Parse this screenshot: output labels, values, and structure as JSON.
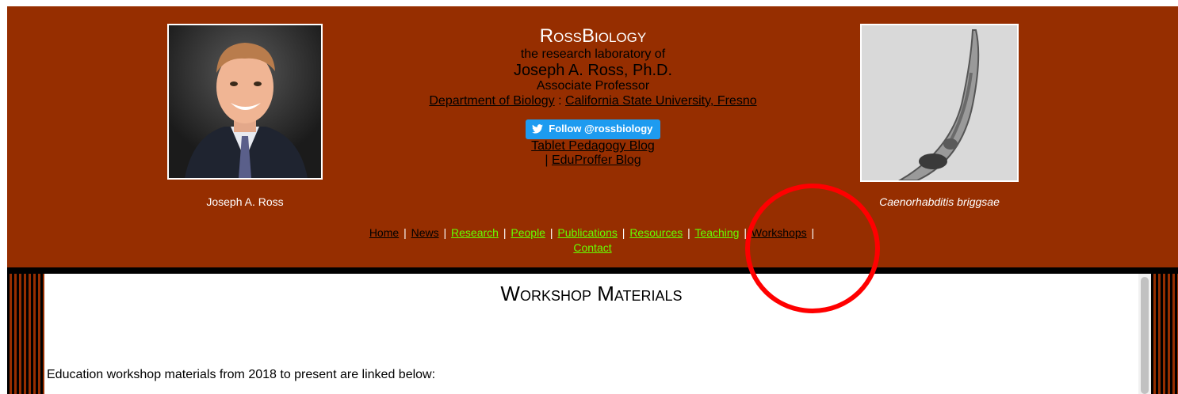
{
  "header": {
    "portrait_caption": "Joseph A. Ross",
    "worm_caption": "Caenorhabditis briggsae",
    "site_title": "RossBiology",
    "subtitle": "the research laboratory of",
    "pi_name": "Joseph A. Ross, Ph.D.",
    "pi_title": "Associate Professor",
    "department_link": "Department of Biology",
    "dept_separator": ":",
    "university_link": "California State University, Fresno",
    "follow_button": "Follow @rossbiology",
    "blog_link": "Tablet Pedagogy Blog",
    "blog_separator": "|",
    "eduproffer_link": "EduProffer Blog"
  },
  "nav": {
    "separator": "|",
    "items": [
      {
        "label": "Home",
        "color": "#000000"
      },
      {
        "label": "News",
        "color": "#000000"
      },
      {
        "label": "Research",
        "color": "#66ff00"
      },
      {
        "label": "People",
        "color": "#66ff00"
      },
      {
        "label": "Publications",
        "color": "#66ff00"
      },
      {
        "label": "Resources",
        "color": "#66ff00"
      },
      {
        "label": "Teaching",
        "color": "#66ff00"
      },
      {
        "label": "Workshops",
        "color": "#000000"
      },
      {
        "label": "Contact",
        "color": "#66ff00"
      }
    ]
  },
  "content": {
    "title": "Workshop Materials",
    "intro": "Education workshop materials from 2018 to present are linked below:"
  },
  "colors": {
    "header_bg": "#962e00",
    "nav_link_green": "#66ff00",
    "annotation_circle": "#ff0000",
    "twitter_blue": "#1d9bf0"
  },
  "icons": {
    "follow_button_icon": "twitter-bird-icon"
  }
}
